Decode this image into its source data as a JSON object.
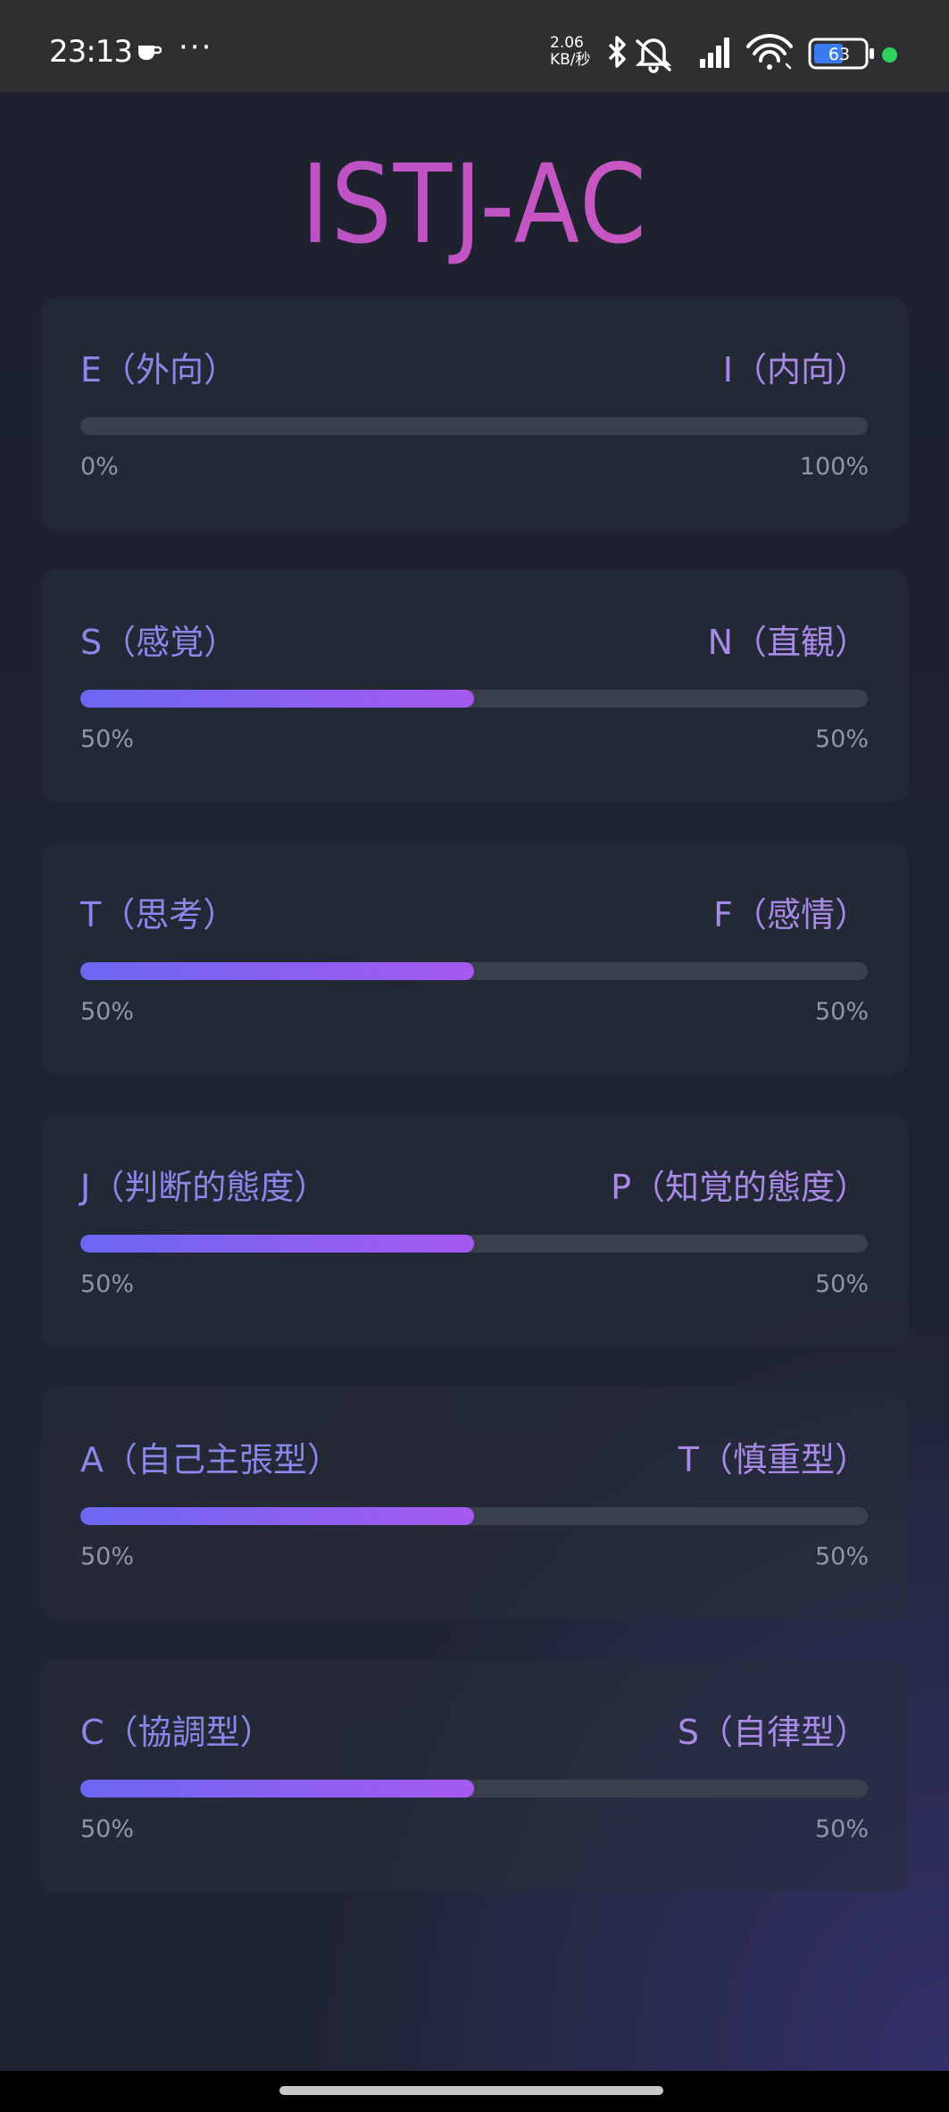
{
  "status_bar": {
    "time": "23:13",
    "more": "···",
    "speed_value": "2.06",
    "speed_unit": "KB/秒",
    "battery_level": "63",
    "icons": [
      "cup-icon",
      "bluetooth-icon",
      "mute-icon",
      "signal-icon",
      "wifi-icon",
      "battery-icon"
    ]
  },
  "title": "ISTJ-AC",
  "colors": {
    "title": "#c551c7",
    "label_left": "#8c86e8",
    "label_right": "#a88ae6",
    "bar_start": "#6b67f2",
    "bar_end": "#a559ef",
    "track": "#3a3f4e"
  },
  "scales": [
    {
      "left_label": "E（外向）",
      "right_label": "I（内向）",
      "left_pct": "0%",
      "right_pct": "100%",
      "fill": 0.0
    },
    {
      "left_label": "S（感覚）",
      "right_label": "N（直観）",
      "left_pct": "50%",
      "right_pct": "50%",
      "fill": 0.5
    },
    {
      "left_label": "T（思考）",
      "right_label": "F（感情）",
      "left_pct": "50%",
      "right_pct": "50%",
      "fill": 0.5
    },
    {
      "left_label": "J（判断的態度）",
      "right_label": "P（知覚的態度）",
      "left_pct": "50%",
      "right_pct": "50%",
      "fill": 0.5
    },
    {
      "left_label": "A（自己主張型）",
      "right_label": "T（慎重型）",
      "left_pct": "50%",
      "right_pct": "50%",
      "fill": 0.5
    },
    {
      "left_label": "C（協調型）",
      "right_label": "S（自律型）",
      "left_pct": "50%",
      "right_pct": "50%",
      "fill": 0.5
    }
  ]
}
